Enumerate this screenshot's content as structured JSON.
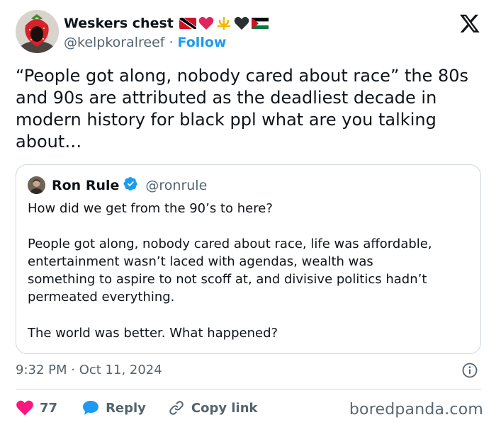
{
  "author": {
    "display_name": "Weskers chest",
    "handle": "@kelpkoralreef",
    "separator": "·",
    "follow_label": "Follow"
  },
  "tweet": {
    "text": "“People got along, nobody cared about race” the 80s and 90s are attributed as the deadliest decade in modern history for black ppl what are you talking about…",
    "timestamp": "9:32 PM · Oct 11, 2024"
  },
  "quoted": {
    "display_name": "Ron Rule",
    "handle": "@ronrule",
    "line1": "How did we get from the 90’s to here?",
    "para2_line1": "People got along, nobody cared about race, life was affordable,",
    "para2_line2": "entertainment wasn’t laced with agendas, wealth was",
    "para2_line3": "something to aspire to not scoff at, and divisive politics hadn’t",
    "para2_line4": "permeated everything.",
    "line_last": "The world was better. What happened?"
  },
  "actions": {
    "like_count": "77",
    "reply_label": "Reply",
    "copy_label": "Copy link"
  },
  "watermark": "boredpanda.com",
  "colors": {
    "link_blue": "#1d9bf0",
    "heart_pink": "#f91880",
    "reply_blue": "#1d9bf0",
    "secondary_text": "#536471"
  },
  "icons": {
    "x_logo": "x-logo-icon",
    "verified": "verified-badge-icon",
    "heart": "heart-icon",
    "reply": "reply-bubble-icon",
    "link": "link-icon",
    "info": "info-icon"
  }
}
